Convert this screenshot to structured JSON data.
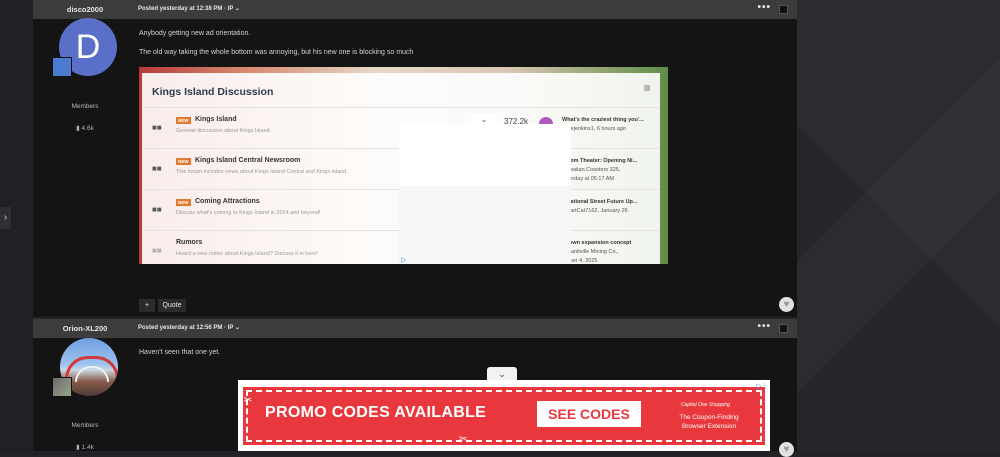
{
  "sidebar": {
    "toggle_icon": "›"
  },
  "post1": {
    "author": "disco2000",
    "avatar_letter": "D",
    "group": "Members",
    "post_count": "4.6k",
    "timestamp": "Posted yesterday at 12:38 PM · IP ⌄",
    "more": "•••",
    "lines": [
      "Anybody getting new ad orientation.",
      "The old way taking the whole bottom was annoying, but his new one is blocking so much"
    ],
    "embed": {
      "title": "Kings Island Discussion",
      "stat": "372.2k",
      "forums": [
        {
          "badge": "NEW",
          "name": "Kings Island",
          "desc": "General discussion about Kings Island.",
          "last_title": "What's the craziest thing you'...",
          "last_meta": "mikejenkins1, 6 hours ago"
        },
        {
          "badge": "NEW",
          "name": "Kings Island Central Newsroom",
          "desc": "This forum includes news about Kings Island Central and Kings Island.",
          "last_title": "antom Theater: Opening Ni...",
          "last_meta": "Hawaiian Coasters 325,",
          "last_meta2": "esterday at 05:17 AM"
        },
        {
          "badge": "NEW",
          "name": "Coming Attractions",
          "desc": "Discuss what's coming to Kings Island in 2024 and beyond!",
          "last_title": "ernational Street Future Up...",
          "last_meta": "SmartCat7162, January 26"
        },
        {
          "badge": "",
          "name": "Rumors",
          "desc": "Heard a new rumor about Kings Island? Discuss it in here!",
          "last_title": "ertown expansion concept",
          "last_meta": "Losantiville Mining Co.,",
          "last_meta2": "ember 4, 2025"
        }
      ]
    },
    "add_label": "+",
    "quote_label": "Quote"
  },
  "post2": {
    "author": "Orion-XL200",
    "group": "Members",
    "post_count": "1.4k",
    "timestamp": "Posted yesterday at 12:56 PM · IP ⌄",
    "more": "•••",
    "lines": [
      "Haven't seen that one yet."
    ]
  },
  "bottom_ad": {
    "tab_icon": "⌄",
    "headline": "PROMO CODES AVAILABLE",
    "cta": "SEE CODES",
    "brand": "Capital One Shopping",
    "tagline_1": "The Coupon-Finding",
    "tagline_2": "Browser Extension",
    "adchoices": "▷ ⁝"
  },
  "colors": {
    "accent_red": "#e8383d",
    "new_badge": "#e07a2d",
    "avatar_blue": "#5a6fc7"
  }
}
